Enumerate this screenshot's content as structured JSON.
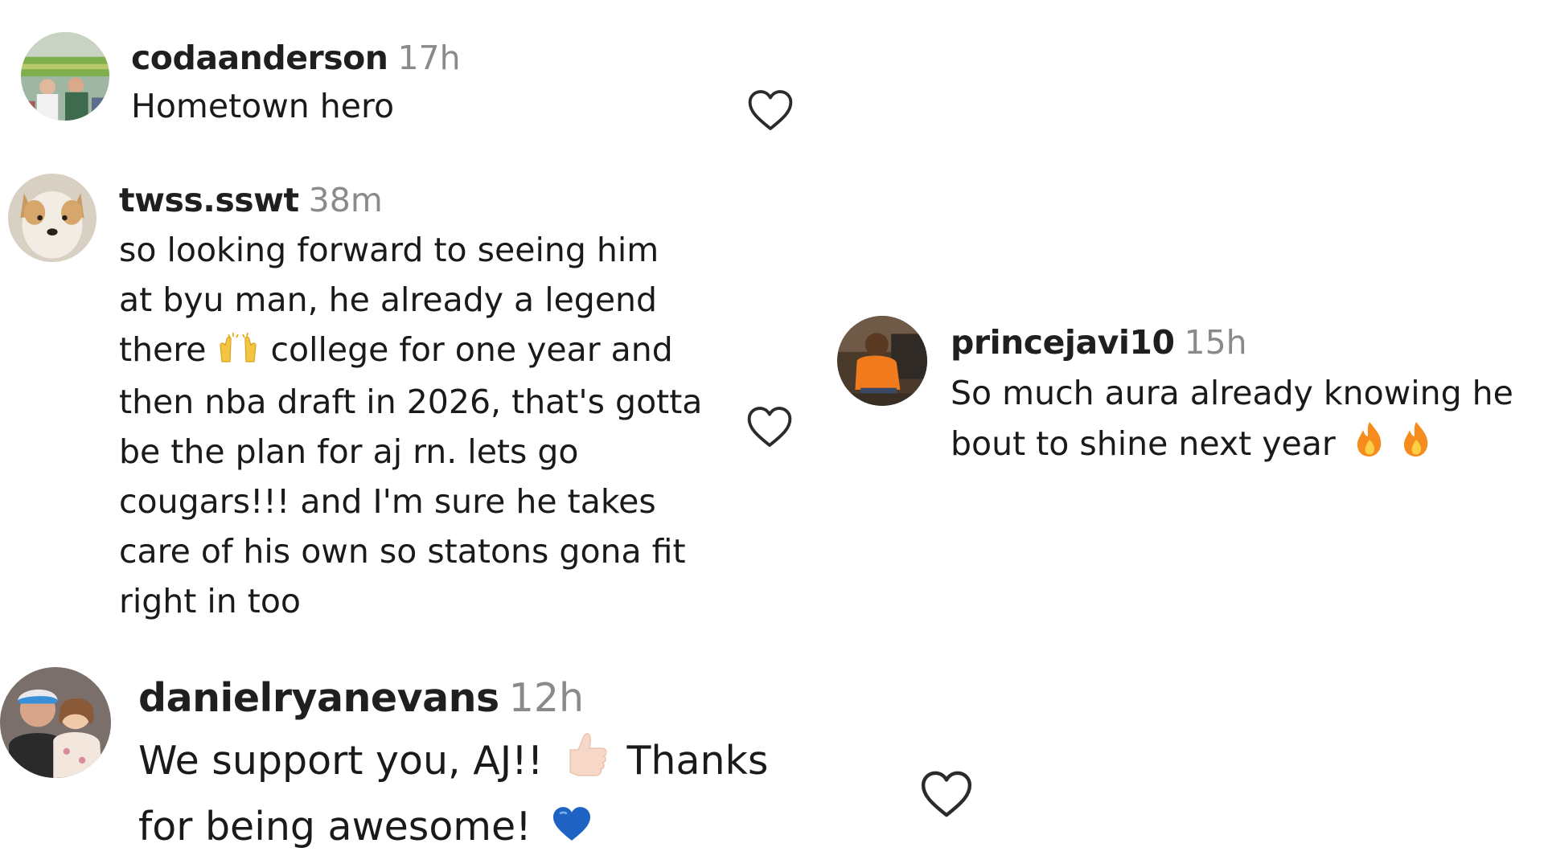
{
  "comments": [
    {
      "username": "codaanderson",
      "time": "17h",
      "lines": [
        "Hometown hero"
      ],
      "avatar_icon": "baseball-stadium-photo-avatar",
      "like_icon": "heart-outline-icon"
    },
    {
      "username": "twss.sswt",
      "time": "38m",
      "lines": [
        "so looking forward to seeing him",
        "at byu man, he already a legend",
        "there",
        "college for one year and",
        "then nba draft in 2026, that's gotta",
        "be the plan for aj rn. lets go",
        "cougars!!! and I'm sure he takes",
        "care of his own so statons gona fit",
        "right in too"
      ],
      "emoji": [
        "raising-hands-emoji"
      ],
      "avatar_icon": "dog-photo-avatar",
      "like_icon": "heart-outline-icon"
    },
    {
      "username": "princejavi10",
      "time": "15h",
      "lines": [
        "So much aura already knowing he",
        "bout to shine next year"
      ],
      "emoji": [
        "fire-emoji",
        "fire-emoji"
      ],
      "avatar_icon": "child-orange-shirt-photo-avatar"
    },
    {
      "username": "danielryanevans",
      "time": "12h",
      "lines": [
        "We support you, AJ!!",
        "Thanks",
        "for being awesome!"
      ],
      "emoji": [
        "thumbs-up-emoji",
        "blue-heart-emoji"
      ],
      "avatar_icon": "father-daughter-photo-avatar",
      "like_icon": "heart-outline-icon"
    }
  ],
  "colors": {
    "username": "#1f1f1f",
    "timestamp": "#8a8a8a",
    "text": "#1a1a1a",
    "heart_stroke": "#2b2b2b",
    "fire": "#f78c1e",
    "blue_heart": "#1e63c4"
  }
}
